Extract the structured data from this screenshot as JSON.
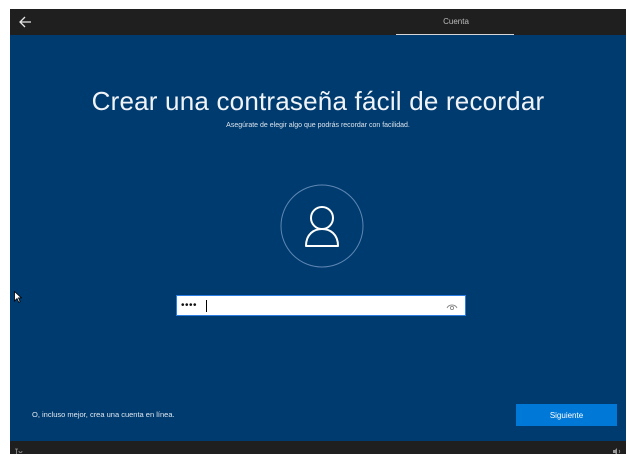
{
  "header": {
    "back_icon": "arrow-left-icon",
    "tab_label": "Cuenta"
  },
  "main": {
    "title": "Crear una contraseña fácil de recordar",
    "subtitle": "Asegúrate de elegir algo que podrás recordar con facilidad.",
    "avatar_icon": "user-icon",
    "password": {
      "masked_value": "••••",
      "reveal_icon": "eye-icon"
    }
  },
  "footer": {
    "online_account_link": "O, incluso mejor, crea una cuenta en línea.",
    "next_button": "Siguiente"
  },
  "taskbar": {
    "left_icon": "accessibility-icon",
    "right_icon": "volume-icon"
  },
  "colors": {
    "background": "#003b6f",
    "accent": "#0078d7",
    "topbar": "#1f1f1f"
  }
}
